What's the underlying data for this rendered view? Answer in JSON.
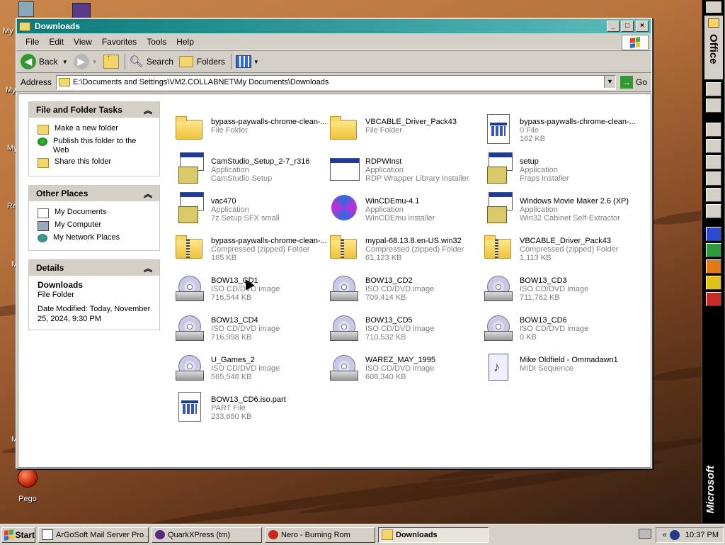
{
  "desktop": {
    "labels": [
      "My",
      "My",
      "My",
      "Re",
      "M",
      "M"
    ],
    "pego_label": "Pego"
  },
  "window": {
    "title": "Downloads",
    "min_glyph": "_",
    "max_glyph": "□",
    "close_glyph": "×"
  },
  "menu": [
    "File",
    "Edit",
    "View",
    "Favorites",
    "Tools",
    "Help"
  ],
  "toolbar": {
    "back": "Back",
    "search": "Search",
    "folders": "Folders"
  },
  "address": {
    "label": "Address",
    "value": "E:\\Documents and Settings\\VM2.COLLABNET\\My Documents\\Downloads",
    "go": "Go"
  },
  "tasks_panel": {
    "title": "File and Folder Tasks",
    "items": [
      "Make a new folder",
      "Publish this folder to the Web",
      "Share this folder"
    ]
  },
  "places_panel": {
    "title": "Other Places",
    "items": [
      "My Documents",
      "My Computer",
      "My Network Places"
    ]
  },
  "details_panel": {
    "title": "Details",
    "name": "Downloads",
    "type": "File Folder",
    "modified": "Date Modified: Today, November 25, 2024, 9:30 PM"
  },
  "files": [
    {
      "name": "bypass-paywalls-chrome-clean-...",
      "line2": "File Folder",
      "line3": "",
      "icon": "folder"
    },
    {
      "name": "VBCABLE_Driver_Pack43",
      "line2": "File Folder",
      "line3": "",
      "icon": "folder"
    },
    {
      "name": "bypass-paywalls-chrome-clean-...",
      "line2": "0 File",
      "line3": "162 KB",
      "icon": "document"
    },
    {
      "name": "CamStudio_Setup_2-7_r316",
      "line2": "Application",
      "line3": "CamStudio Setup",
      "icon": "installer"
    },
    {
      "name": "RDPWInst",
      "line2": "Application",
      "line3": "RDP Wrapper Library Installer",
      "icon": "application"
    },
    {
      "name": "setup",
      "line2": "Application",
      "line3": "Fraps Installer",
      "icon": "installer"
    },
    {
      "name": "vac470",
      "line2": "Application",
      "line3": "7z Setup SFX small",
      "icon": "installer"
    },
    {
      "name": "WinCDEmu-4.1",
      "line2": "Application",
      "line3": "WinCDEmu installer",
      "icon": "wincdemu"
    },
    {
      "name": "Windows Movie Maker 2.6 (XP)",
      "line2": "Application",
      "line3": "Win32 Cabinet Self-Extractor",
      "icon": "installer"
    },
    {
      "name": "bypass-paywalls-chrome-clean-...",
      "line2": "Compressed (zipped) Folder",
      "line3": "165 KB",
      "icon": "zip-folder"
    },
    {
      "name": "mypal-68.13.8.en-US.win32",
      "line2": "Compressed (zipped) Folder",
      "line3": "61,123 KB",
      "icon": "zip-folder"
    },
    {
      "name": "VBCABLE_Driver_Pack43",
      "line2": "Compressed (zipped) Folder",
      "line3": "1,113 KB",
      "icon": "zip-folder"
    },
    {
      "name": "BOW13_CD1",
      "line2": "ISO CD/DVD image",
      "line3": "716,544 KB",
      "icon": "disc-image"
    },
    {
      "name": "BOW13_CD2",
      "line2": "ISO CD/DVD image",
      "line3": "709,414 KB",
      "icon": "disc-image"
    },
    {
      "name": "BOW13_CD3",
      "line2": "ISO CD/DVD image",
      "line3": "711,762 KB",
      "icon": "disc-image"
    },
    {
      "name": "BOW13_CD4",
      "line2": "ISO CD/DVD image",
      "line3": "716,998 KB",
      "icon": "disc-image"
    },
    {
      "name": "BOW13_CD5",
      "line2": "ISO CD/DVD image",
      "line3": "710,532 KB",
      "icon": "disc-image"
    },
    {
      "name": "BOW13_CD6",
      "line2": "ISO CD/DVD image",
      "line3": "0 KB",
      "icon": "disc-image"
    },
    {
      "name": "U_Games_2",
      "line2": "ISO CD/DVD image",
      "line3": "565,548 KB",
      "icon": "disc-image"
    },
    {
      "name": "WAREZ_MAY_1995",
      "line2": "ISO CD/DVD image",
      "line3": "608,340 KB",
      "icon": "disc-image"
    },
    {
      "name": "Mike Oldfield - Ommadawn1",
      "line2": "MIDI Sequence",
      "line3": "",
      "icon": "midi"
    },
    {
      "name": "BOW13_CD6.iso.part",
      "line2": "PART File",
      "line3": "233,680 KB",
      "icon": "document"
    }
  ],
  "office_bar": {
    "title": "Office",
    "brand": "Microsoft"
  },
  "taskbar": {
    "start": "Start",
    "buttons": [
      "ArGoSoft Mail Server Pro ...",
      "QuarkXPress (tm)",
      "Nero - Burning Rom",
      "Downloads"
    ],
    "tray_chevron": "«",
    "clock": "10:37 PM"
  }
}
